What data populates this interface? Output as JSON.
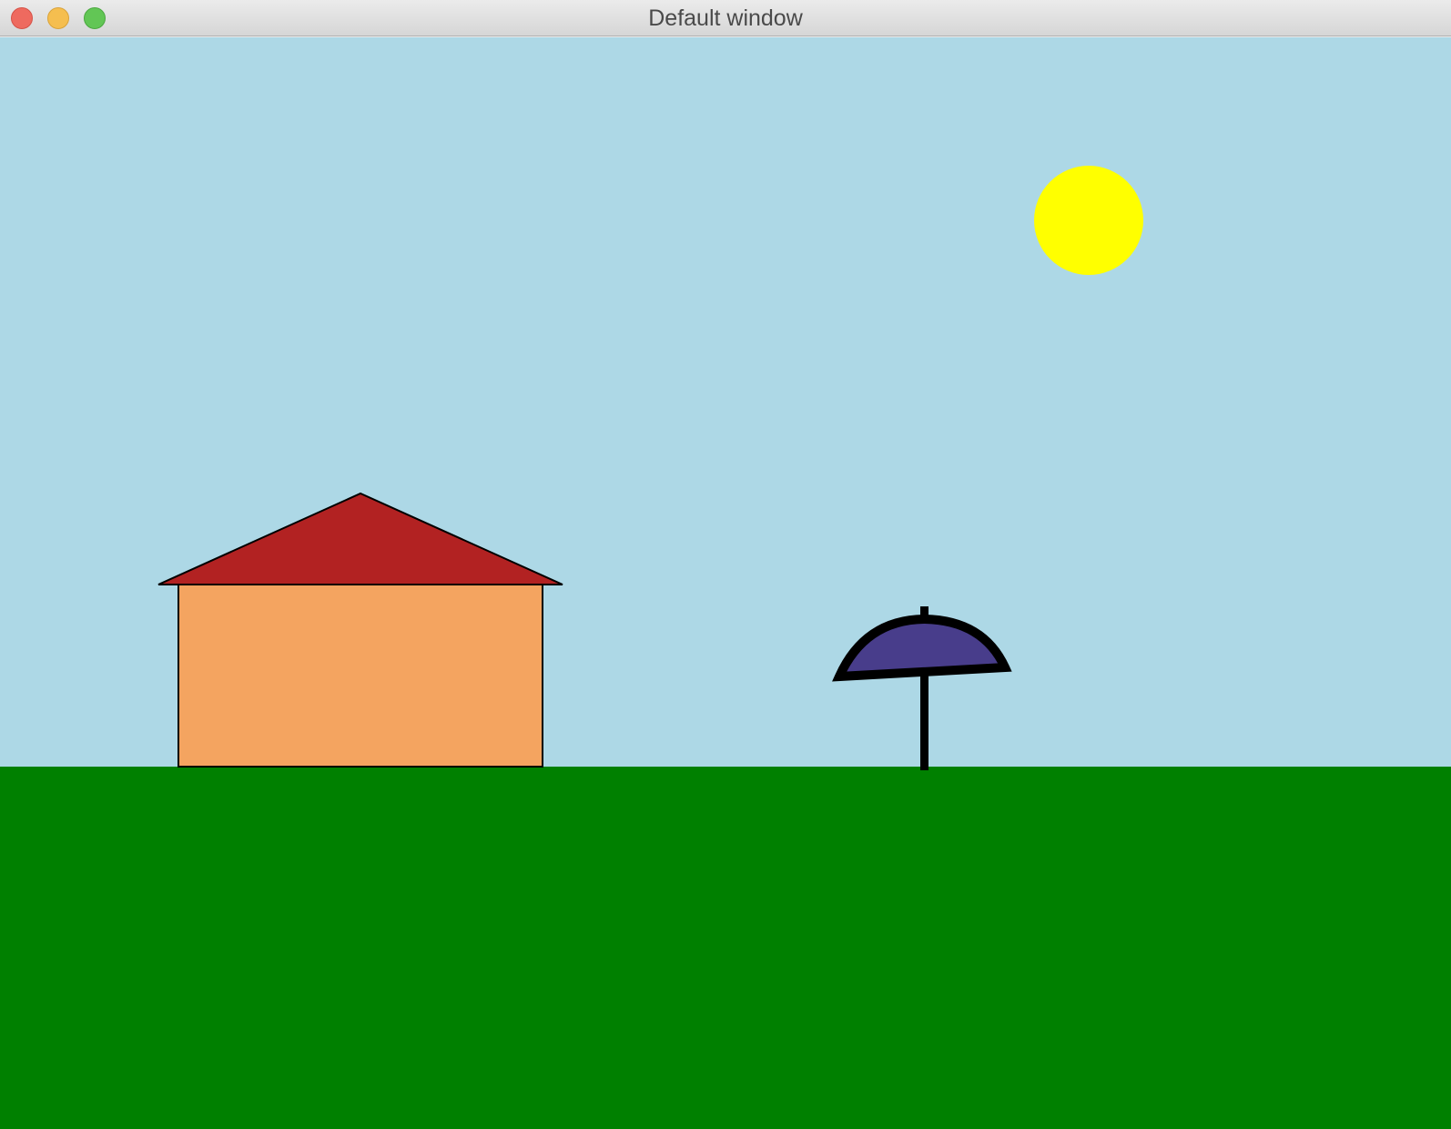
{
  "window": {
    "title": "Default window",
    "buttons": [
      "close",
      "minimize",
      "zoom"
    ]
  },
  "scene": {
    "sky_color": "#add8e6",
    "ground_color": "#008000",
    "sun_color": "#ffff00",
    "house_wall_color": "#f4a460",
    "house_roof_color": "#b22222",
    "umbrella_canopy_color": "#483d8b",
    "outline_color": "#000000"
  }
}
